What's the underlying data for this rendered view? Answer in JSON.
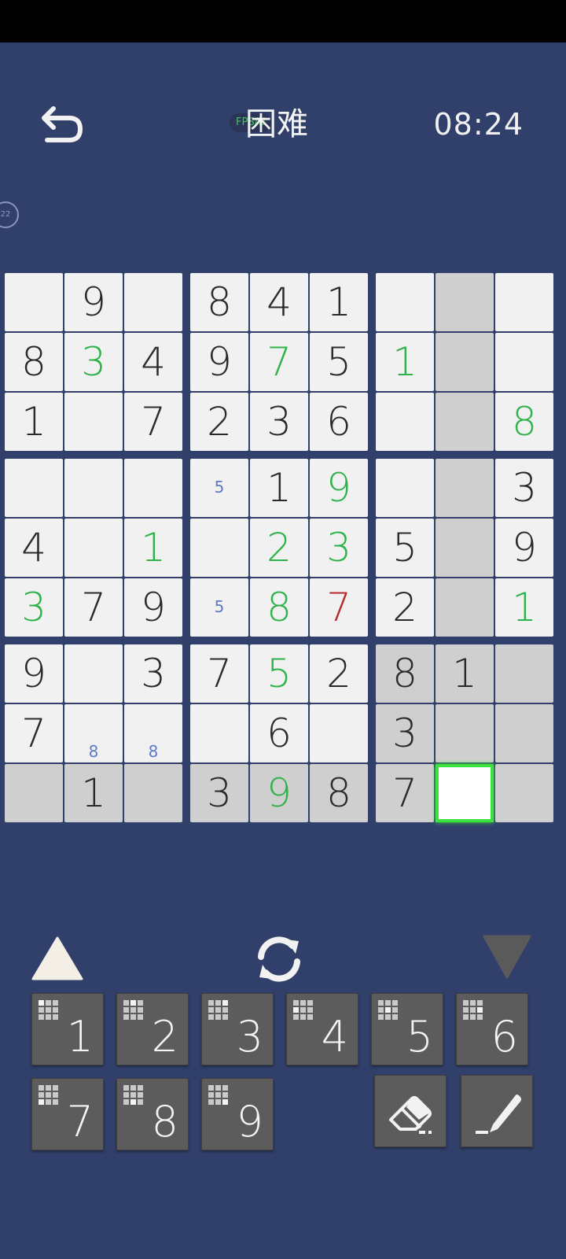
{
  "header": {
    "title": "困难",
    "fps_badge": "FPS/U",
    "timer": "08:24",
    "side_badge": "22"
  },
  "board": {
    "rows": [
      [
        {
          "v": ""
        },
        {
          "v": "9"
        },
        {
          "v": ""
        },
        {
          "v": "8"
        },
        {
          "v": "4"
        },
        {
          "v": "1"
        },
        {
          "v": ""
        },
        {
          "v": "",
          "shade": true
        },
        {
          "v": ""
        }
      ],
      [
        {
          "v": "8"
        },
        {
          "v": "3",
          "user": true
        },
        {
          "v": "4"
        },
        {
          "v": "9"
        },
        {
          "v": "7",
          "user": true
        },
        {
          "v": "5"
        },
        {
          "v": "1",
          "user": true
        },
        {
          "v": "",
          "shade": true
        },
        {
          "v": ""
        }
      ],
      [
        {
          "v": "1"
        },
        {
          "v": ""
        },
        {
          "v": "7"
        },
        {
          "v": "2"
        },
        {
          "v": "3"
        },
        {
          "v": "6"
        },
        {
          "v": ""
        },
        {
          "v": "",
          "shade": true
        },
        {
          "v": "8",
          "user": true
        }
      ],
      [
        {
          "v": ""
        },
        {
          "v": ""
        },
        {
          "v": ""
        },
        {
          "v": "",
          "note": "5",
          "notepos": "center"
        },
        {
          "v": "1"
        },
        {
          "v": "9",
          "user": true
        },
        {
          "v": ""
        },
        {
          "v": "",
          "shade": true
        },
        {
          "v": "3"
        }
      ],
      [
        {
          "v": "4"
        },
        {
          "v": ""
        },
        {
          "v": "1",
          "user": true
        },
        {
          "v": ""
        },
        {
          "v": "2",
          "user": true
        },
        {
          "v": "3",
          "user": true
        },
        {
          "v": "5"
        },
        {
          "v": "",
          "shade": true
        },
        {
          "v": "9"
        }
      ],
      [
        {
          "v": "3",
          "user": true
        },
        {
          "v": "7"
        },
        {
          "v": "9"
        },
        {
          "v": "",
          "note": "5",
          "notepos": "center"
        },
        {
          "v": "8",
          "user": true
        },
        {
          "v": "7",
          "error": true
        },
        {
          "v": "2"
        },
        {
          "v": "",
          "shade": true
        },
        {
          "v": "1",
          "user": true
        }
      ],
      [
        {
          "v": "9"
        },
        {
          "v": ""
        },
        {
          "v": "3"
        },
        {
          "v": "7"
        },
        {
          "v": "5",
          "user": true
        },
        {
          "v": "2"
        },
        {
          "v": "8",
          "shade": true
        },
        {
          "v": "1",
          "shade": true
        },
        {
          "v": "",
          "shade": true
        }
      ],
      [
        {
          "v": "7"
        },
        {
          "v": "",
          "note": "8",
          "notepos": "bottom"
        },
        {
          "v": "",
          "note": "8",
          "notepos": "bottom"
        },
        {
          "v": ""
        },
        {
          "v": "6"
        },
        {
          "v": ""
        },
        {
          "v": "3",
          "shade": true
        },
        {
          "v": "",
          "shade": true
        },
        {
          "v": "",
          "shade": true
        }
      ],
      [
        {
          "v": "",
          "shade": true
        },
        {
          "v": "1",
          "shade": true
        },
        {
          "v": "",
          "shade": true
        },
        {
          "v": "3",
          "shade": true
        },
        {
          "v": "9",
          "user": true,
          "shade": true
        },
        {
          "v": "8",
          "shade": true
        },
        {
          "v": "7",
          "shade": true
        },
        {
          "v": "",
          "selected": true
        },
        {
          "v": "",
          "shade": true
        }
      ]
    ]
  },
  "keypad": {
    "numbers": [
      "1",
      "2",
      "3",
      "4",
      "5",
      "6",
      "7",
      "8",
      "9"
    ]
  },
  "colors": {
    "background": "#31406a",
    "cell": "#f1f1f1",
    "cell_shaded": "#cfcfcf",
    "user_digit": "#2fb24a",
    "error_digit": "#b82a2a",
    "note": "#5f7ac6",
    "selected_border": "#3ee23e",
    "key": "#5c5c5c"
  },
  "icons": {
    "back": "undo-arrow-icon",
    "up": "triangle-up-icon",
    "refresh": "refresh-icon",
    "down": "triangle-down-icon",
    "eraser": "eraser-icon",
    "pencil": "pencil-icon"
  }
}
